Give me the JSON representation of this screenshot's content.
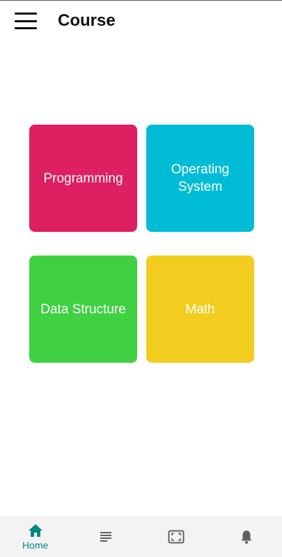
{
  "header": {
    "title": "Course",
    "menu_icon": "hamburger-menu-icon"
  },
  "colors": {
    "programming": "#de1f62",
    "operating_system": "#00bcd6",
    "data_structure": "#3fd142",
    "math": "#f2cd1f",
    "nav_active": "#00897b",
    "nav_inactive": "#616161"
  },
  "courses": [
    {
      "label": "Programming"
    },
    {
      "label": "Operating\nSystem"
    },
    {
      "label": "Data Structure"
    },
    {
      "label": "Math"
    }
  ],
  "bottom_nav": {
    "items": [
      {
        "icon": "home-icon",
        "label": "Home",
        "active": true
      },
      {
        "icon": "notes-icon",
        "label": "",
        "active": false
      },
      {
        "icon": "fullscreen-icon",
        "label": "",
        "active": false
      },
      {
        "icon": "bell-icon",
        "label": "",
        "active": false
      }
    ]
  }
}
